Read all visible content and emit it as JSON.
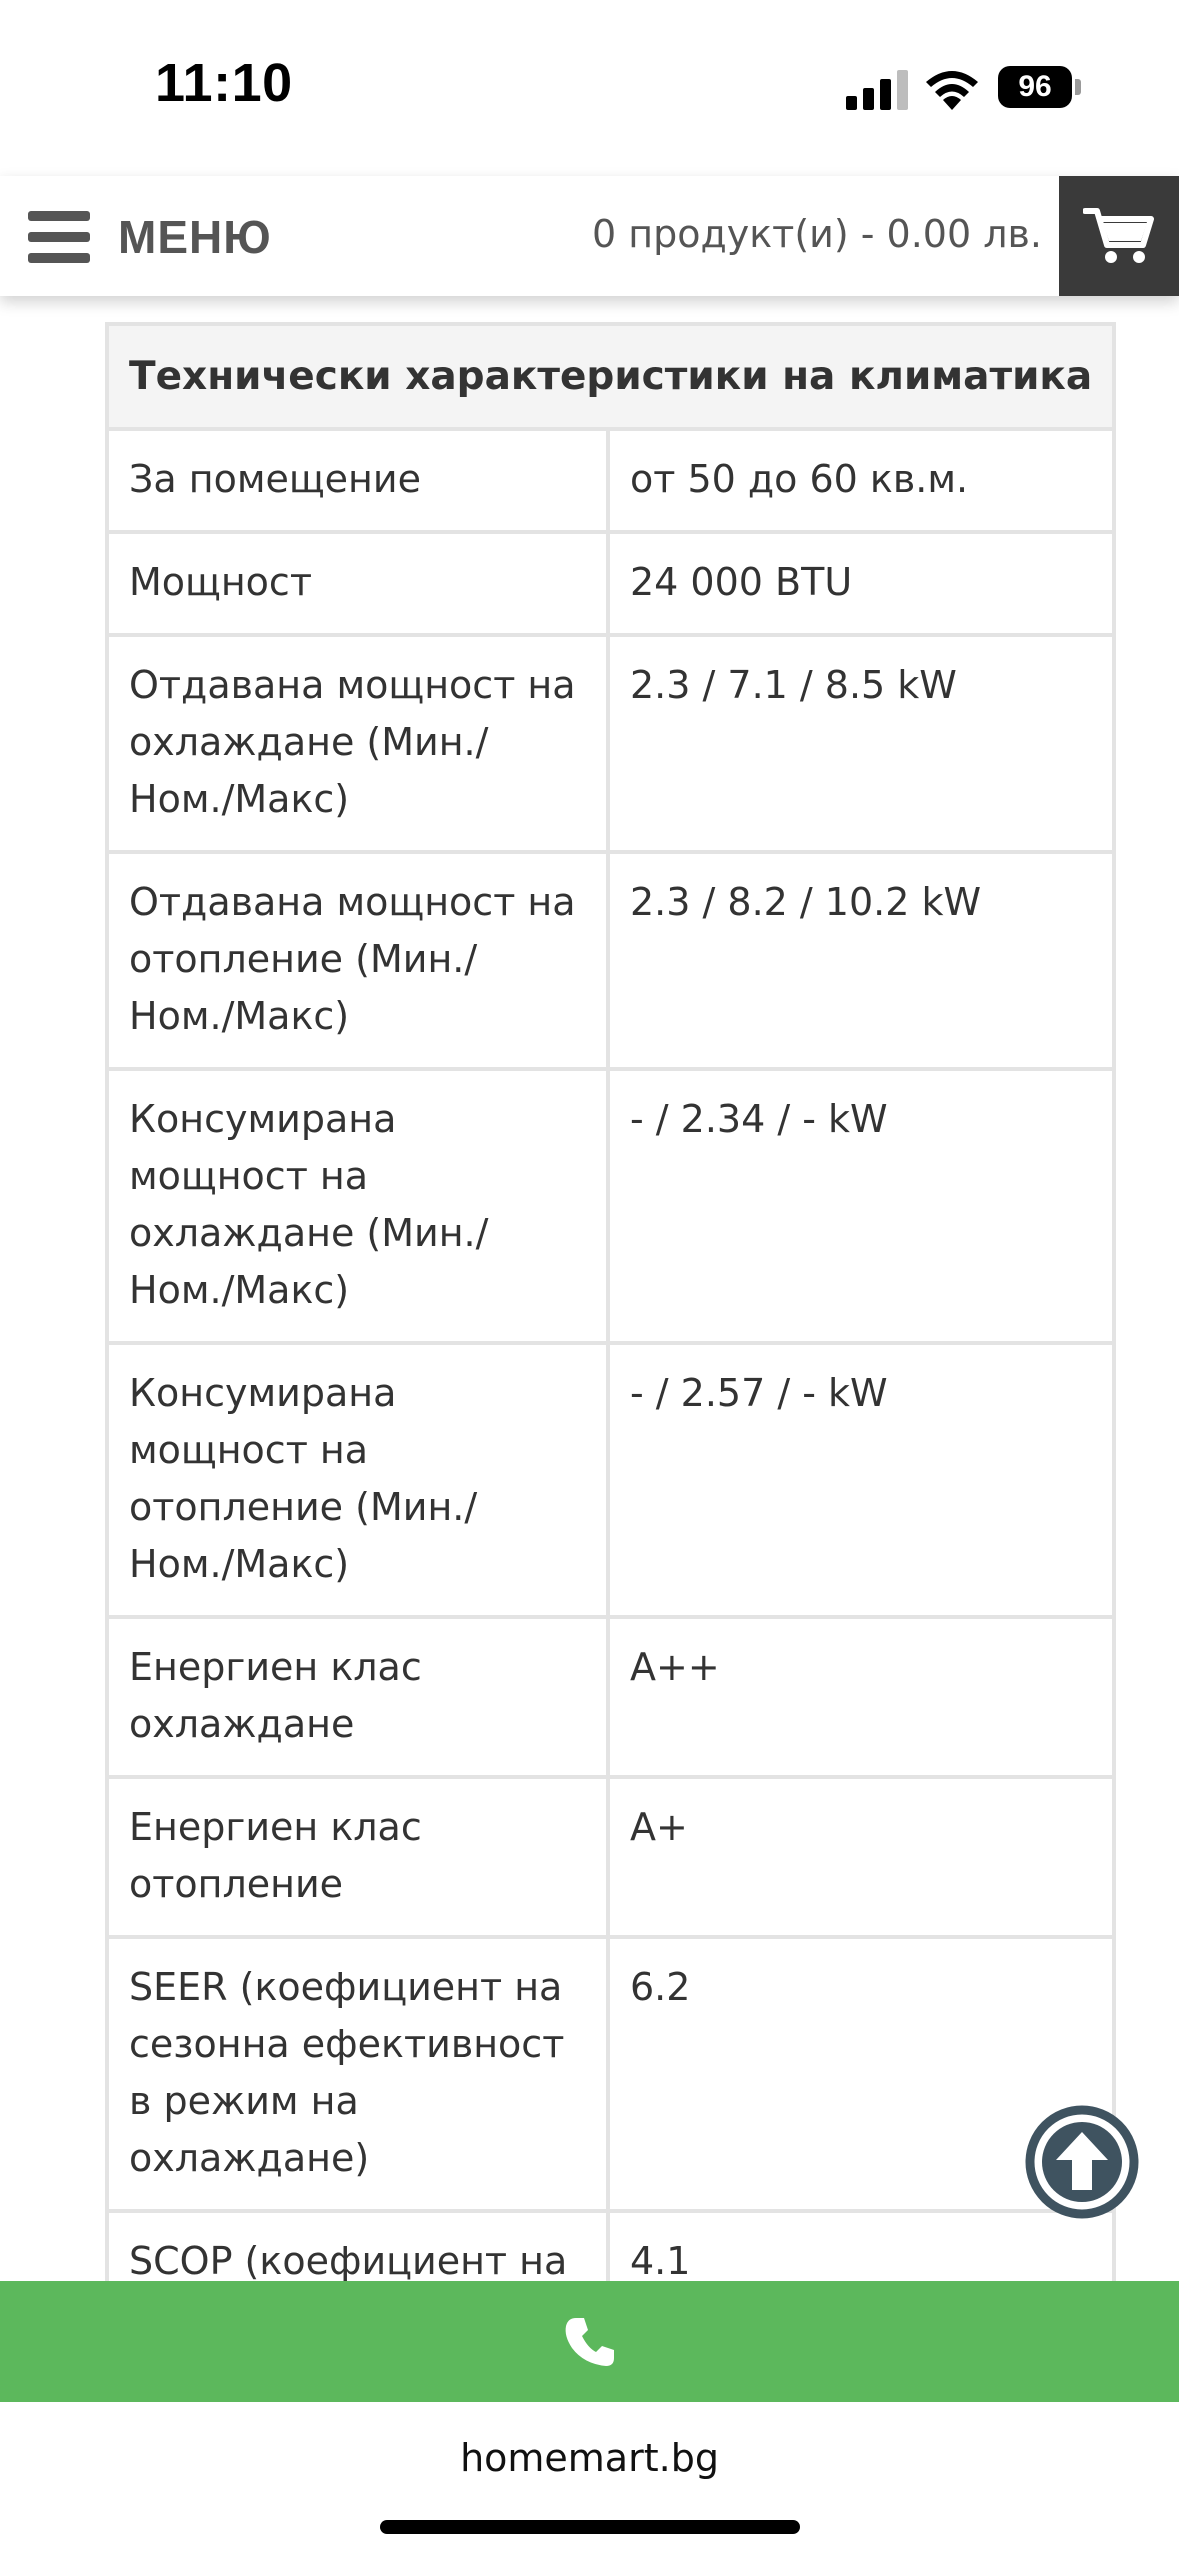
{
  "status_bar": {
    "time": "11:10",
    "battery": "96"
  },
  "header": {
    "menu_label": "МЕНЮ",
    "cart_summary": "0 продукт(и) - 0.00 лв.",
    "cart_icon": "shopping-cart-icon",
    "menu_icon": "hamburger-icon"
  },
  "specs": {
    "title": "Технически характеристики на климатика",
    "rows": [
      {
        "label": "За помещение",
        "value": "от 50 до 60 кв.м."
      },
      {
        "label": "Мощност",
        "value": "24 000 BTU"
      },
      {
        "label": "Отдавана мощност на охлаждане (Мин./ Ном./Макс)",
        "value": "2.3 / 7.1 / 8.5 kW"
      },
      {
        "label": "Отдавана мощност на отопление (Мин./ Ном./Макс)",
        "value": "2.3 / 8.2 / 10.2 kW"
      },
      {
        "label": "Консумирана мощност на охлаждане (Мин./ Ном./Макс)",
        "value": "- / 2.34 / - kW"
      },
      {
        "label": "Консумирана мощност на отопление (Мин./ Ном./Макс)",
        "value": "- / 2.57 / - kW"
      },
      {
        "label": "Енергиен клас охлаждане",
        "value": "A++"
      },
      {
        "label": "Енергиен клас отопление",
        "value": "A+"
      },
      {
        "label": "SEER (коефициент на сезонна ефективност в режим на охлаждане)",
        "value": "6.2"
      },
      {
        "label": "SCOP (коефициент на",
        "value": "4.1"
      }
    ]
  },
  "floating": {
    "scroll_top_icon": "arrow-up-circle-icon",
    "call_icon": "phone-icon"
  },
  "browser": {
    "url": "homemart.bg"
  },
  "colors": {
    "call_bar": "#5cb85c",
    "cart_button": "#3a3a3a",
    "scroll_top": "#3f5360"
  }
}
